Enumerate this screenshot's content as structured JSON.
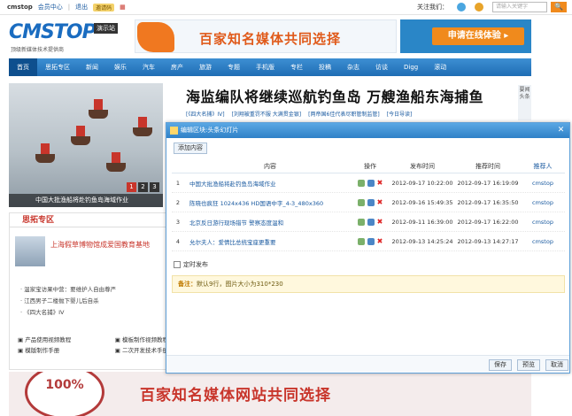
{
  "topbar": {
    "logo_text": "cmstop",
    "member": "会员中心",
    "logout": "退出",
    "badge": "邀请码",
    "follow": "关注我们：",
    "search_placeholder": "请输入关键字",
    "search_btn": "🔍"
  },
  "header": {
    "logo": "CMSTOP",
    "logo_tag": "演示站",
    "logo_sub": "顶级新媒体技术提供商",
    "banner1_text": "百家知名媒体共同选择",
    "banner2_btn": "申请在线体验 ▸"
  },
  "nav": [
    "首页",
    "思拓专区",
    "新闻",
    "娱乐",
    "汽车",
    "房产",
    "旅游",
    "专题",
    "手机版",
    "专栏",
    "投稿",
    "杂志",
    "访谈",
    "Digg",
    "滚动"
  ],
  "photo": {
    "caption": "中国大批渔船将赴钓鱼岛海域作业",
    "pages": [
      "1",
      "2",
      "3"
    ]
  },
  "headline": "海监编队将继续巡航钓鱼岛 万艘渔船东海捕鱼",
  "subs": [
    "[《四大名捕》IV]",
    "[刘翔被重罚不服 大满贯金银]",
    "[两帝国6佳代表尽职管制监管]",
    "[今日导读]"
  ],
  "side_hint": "要闻头条",
  "zone": {
    "title": "思拓专区",
    "feature": "上海假草博物馆成爱国教育基地",
    "items": [
      "· 温家宝访果中营：要维护人自由尊严",
      "· 江西男子二楼抛下婴儿后自杀",
      "· 《四大名捕》IV"
    ]
  },
  "links": [
    [
      "产品使用视频教程",
      "模板制作视频教程"
    ],
    [
      "模版制作手册",
      "二次开发技术手册"
    ]
  ],
  "footer_banner": {
    "stamp": "100%",
    "text": "百家知名媒体网站共同选择"
  },
  "dialog": {
    "title": "编辑区块:头条幻灯片",
    "add_btn": "添加内容",
    "columns": [
      "内容",
      "操作",
      "发布时间",
      "推荐时间",
      "推荐人"
    ],
    "rows": [
      {
        "n": "1",
        "title": "中国大批渔船将赴钓鱼岛海域作业",
        "pub": "2012-09-17 10:22:00",
        "rec": "2012-09-17 16:19:09",
        "by": "cmstop"
      },
      {
        "n": "2",
        "title": "陈晓也疯狂 1024x436 HD国语中字_4-3_480x360",
        "pub": "2012-09-16 15:49:35",
        "rec": "2012-09-17 16:35:50",
        "by": "cmstop"
      },
      {
        "n": "3",
        "title": "北京反日游行现场错节 警察态度温和",
        "pub": "2012-09-11 16:39:00",
        "rec": "2012-09-17 16:22:00",
        "by": "cmstop"
      },
      {
        "n": "4",
        "title": "允尔夫人：爱情比总统宝座更重要",
        "pub": "2012-09-13 14:25:24",
        "rec": "2012-09-13 14:27:17",
        "by": "cmstop"
      }
    ],
    "timer_label": "定时发布",
    "note_label": "备注：",
    "note_text": "默认9行，图片大小为310*230",
    "save": "保存",
    "preview": "预览",
    "cancel": "取消"
  },
  "colors": {
    "nav": "#1f6db4",
    "accent": "#c8352b",
    "orange": "#f08a1c"
  }
}
